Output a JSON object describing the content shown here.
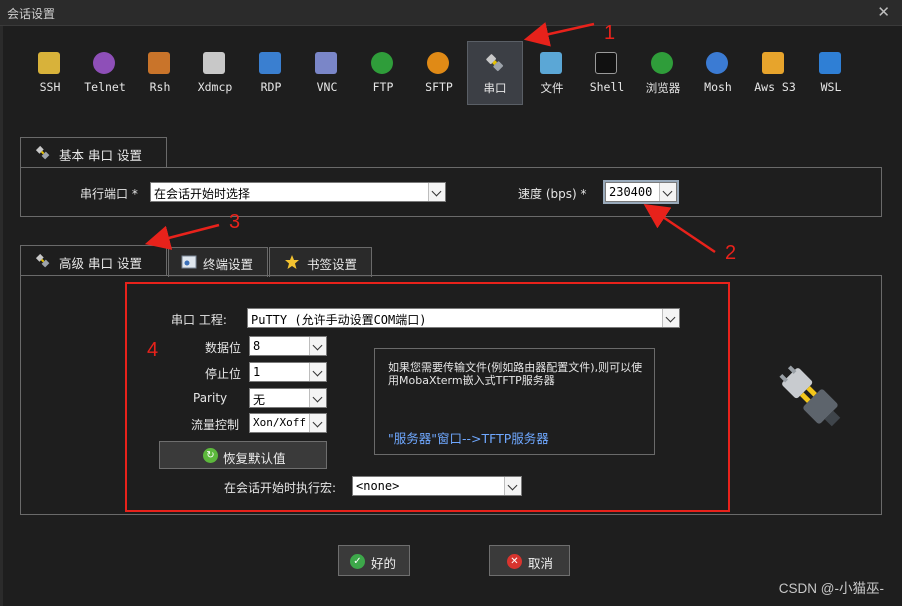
{
  "window": {
    "title": "会话设置",
    "close_glyph": "✕"
  },
  "session_types": [
    {
      "label": "SSH",
      "icon": "key-icon"
    },
    {
      "label": "Telnet",
      "icon": "gem-icon"
    },
    {
      "label": "Rsh",
      "icon": "gear-icon"
    },
    {
      "label": "Xdmcp",
      "icon": "x-window-icon"
    },
    {
      "label": "RDP",
      "icon": "monitor-icon"
    },
    {
      "label": "VNC",
      "icon": "vnc-icon"
    },
    {
      "label": "FTP",
      "icon": "globe-icon"
    },
    {
      "label": "SFTP",
      "icon": "orange-globe-icon"
    },
    {
      "label": "串口",
      "icon": "serial-plug-icon",
      "selected": true
    },
    {
      "label": "文件",
      "icon": "file-monitor-icon"
    },
    {
      "label": "Shell",
      "icon": "terminal-icon"
    },
    {
      "label": "浏览器",
      "icon": "browser-globe-icon"
    },
    {
      "label": "Mosh",
      "icon": "satellite-icon"
    },
    {
      "label": "Aws S3",
      "icon": "aws-cubes-icon"
    },
    {
      "label": "WSL",
      "icon": "windows-icon"
    }
  ],
  "basic": {
    "tab_label": "基本 串口 设置",
    "port_label": "串行端口 *",
    "port_value": "在会话开始时选择",
    "speed_label": "速度 (bps) *",
    "speed_value": "230400"
  },
  "advanced_tabs": [
    {
      "label": "高级 串口 设置",
      "active": true,
      "icon": "plug-icon"
    },
    {
      "label": "终端设置",
      "active": false,
      "icon": "terminal-settings-icon"
    },
    {
      "label": "书签设置",
      "active": false,
      "icon": "star-icon"
    }
  ],
  "advanced": {
    "engine_label": "串口 工程:",
    "engine_value": "PuTTY  (允许手动设置COM端口)",
    "databits_label": "数据位",
    "databits_value": "8",
    "stopbits_label": "停止位",
    "stopbits_value": "1",
    "parity_label": "Parity",
    "parity_value": "无",
    "flow_label": "流量控制",
    "flow_value": "Xon/Xoff",
    "restore_button": "恢复默认值",
    "macro_label": "在会话开始时执行宏:",
    "macro_value": "<none>",
    "info_text": "如果您需要传输文件(例如路由器配置文件),则可以使用MobaXterm嵌入式TFTP服务器",
    "info_link": "\"服务器\"窗口-->TFTP服务器"
  },
  "buttons": {
    "ok": "好的",
    "cancel": "取消"
  },
  "annotations": {
    "n1": "1",
    "n2": "2",
    "n3": "3",
    "n4": "4"
  },
  "colors": {
    "annotation_red": "#e8221b",
    "link_blue": "#6fa8ff",
    "selected_bg": "#3c3f45"
  },
  "watermark": "CSDN @-小猫巫-"
}
